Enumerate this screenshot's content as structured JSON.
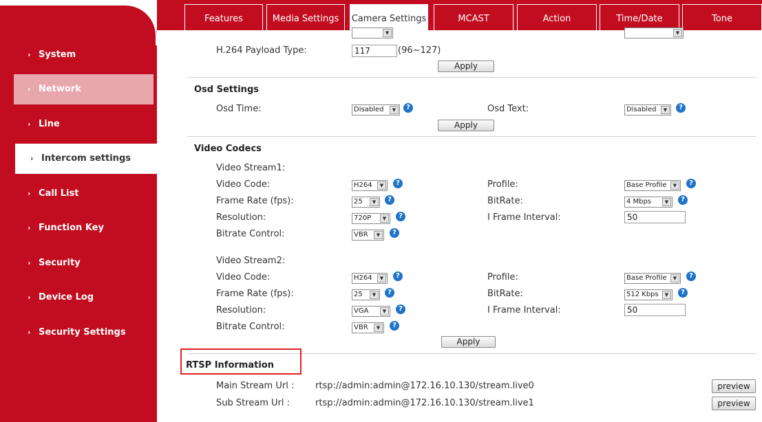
{
  "sidebar": {
    "items": [
      {
        "label": "System"
      },
      {
        "label": "Network"
      },
      {
        "label": "Line"
      },
      {
        "label": "Intercom settings"
      },
      {
        "label": "Call List"
      },
      {
        "label": "Function Key"
      },
      {
        "label": "Security"
      },
      {
        "label": "Device Log"
      },
      {
        "label": "Security Settings"
      }
    ]
  },
  "tabs": [
    {
      "label": "Features"
    },
    {
      "label": "Media Settings"
    },
    {
      "label": "Camera Settings"
    },
    {
      "label": "MCAST"
    },
    {
      "label": "Action"
    },
    {
      "label": "Time/Date"
    },
    {
      "label": "Tone"
    }
  ],
  "payload": {
    "label": "H.264 Payload Type:",
    "value": "117",
    "range": "(96~127)",
    "apply": "Apply"
  },
  "osd": {
    "title": "Osd Settings",
    "time_label": "Osd Time:",
    "time_value": "Disabled",
    "text_label": "Osd Text:",
    "text_value": "Disabled",
    "apply": "Apply"
  },
  "video": {
    "title": "Video Codecs",
    "stream1": {
      "title": "Video Stream1:",
      "code_label": "Video Code:",
      "code_value": "H264",
      "profile_label": "Profile:",
      "profile_value": "Base Profile",
      "fps_label": "Frame Rate (fps):",
      "fps_value": "25",
      "bitrate_label": "BitRate:",
      "bitrate_value": "4 Mbps",
      "res_label": "Resolution:",
      "res_value": "720P",
      "iframe_label": "I Frame Interval:",
      "iframe_value": "50",
      "ctrl_label": "Bitrate Control:",
      "ctrl_value": "VBR"
    },
    "stream2": {
      "title": "Video Stream2:",
      "code_label": "Video Code:",
      "code_value": "H264",
      "profile_label": "Profile:",
      "profile_value": "Base Profile",
      "fps_label": "Frame Rate (fps):",
      "fps_value": "25",
      "bitrate_label": "BitRate:",
      "bitrate_value": "512 Kbps",
      "res_label": "Resolution:",
      "res_value": "VGA",
      "iframe_label": "I Frame Interval:",
      "iframe_value": "50",
      "ctrl_label": "Bitrate Control:",
      "ctrl_value": "VBR"
    },
    "apply": "Apply"
  },
  "rtsp": {
    "title": "RTSP Information",
    "main_label": "Main Stream Url :",
    "main_url": "rtsp://admin:admin@172.16.10.130/stream.live0",
    "sub_label": "Sub Stream Url :",
    "sub_url": "rtsp://admin:admin@172.16.10.130/stream.live1",
    "preview": "preview"
  },
  "icons": {
    "dropdown": "chevron-down-icon",
    "help": "question-icon",
    "nav": "chevron-right-icon"
  },
  "colors": {
    "brand": "#c10d1f",
    "highlight": "#e8a6ad",
    "help": "#1f73c8",
    "annotation": "#e02020"
  }
}
